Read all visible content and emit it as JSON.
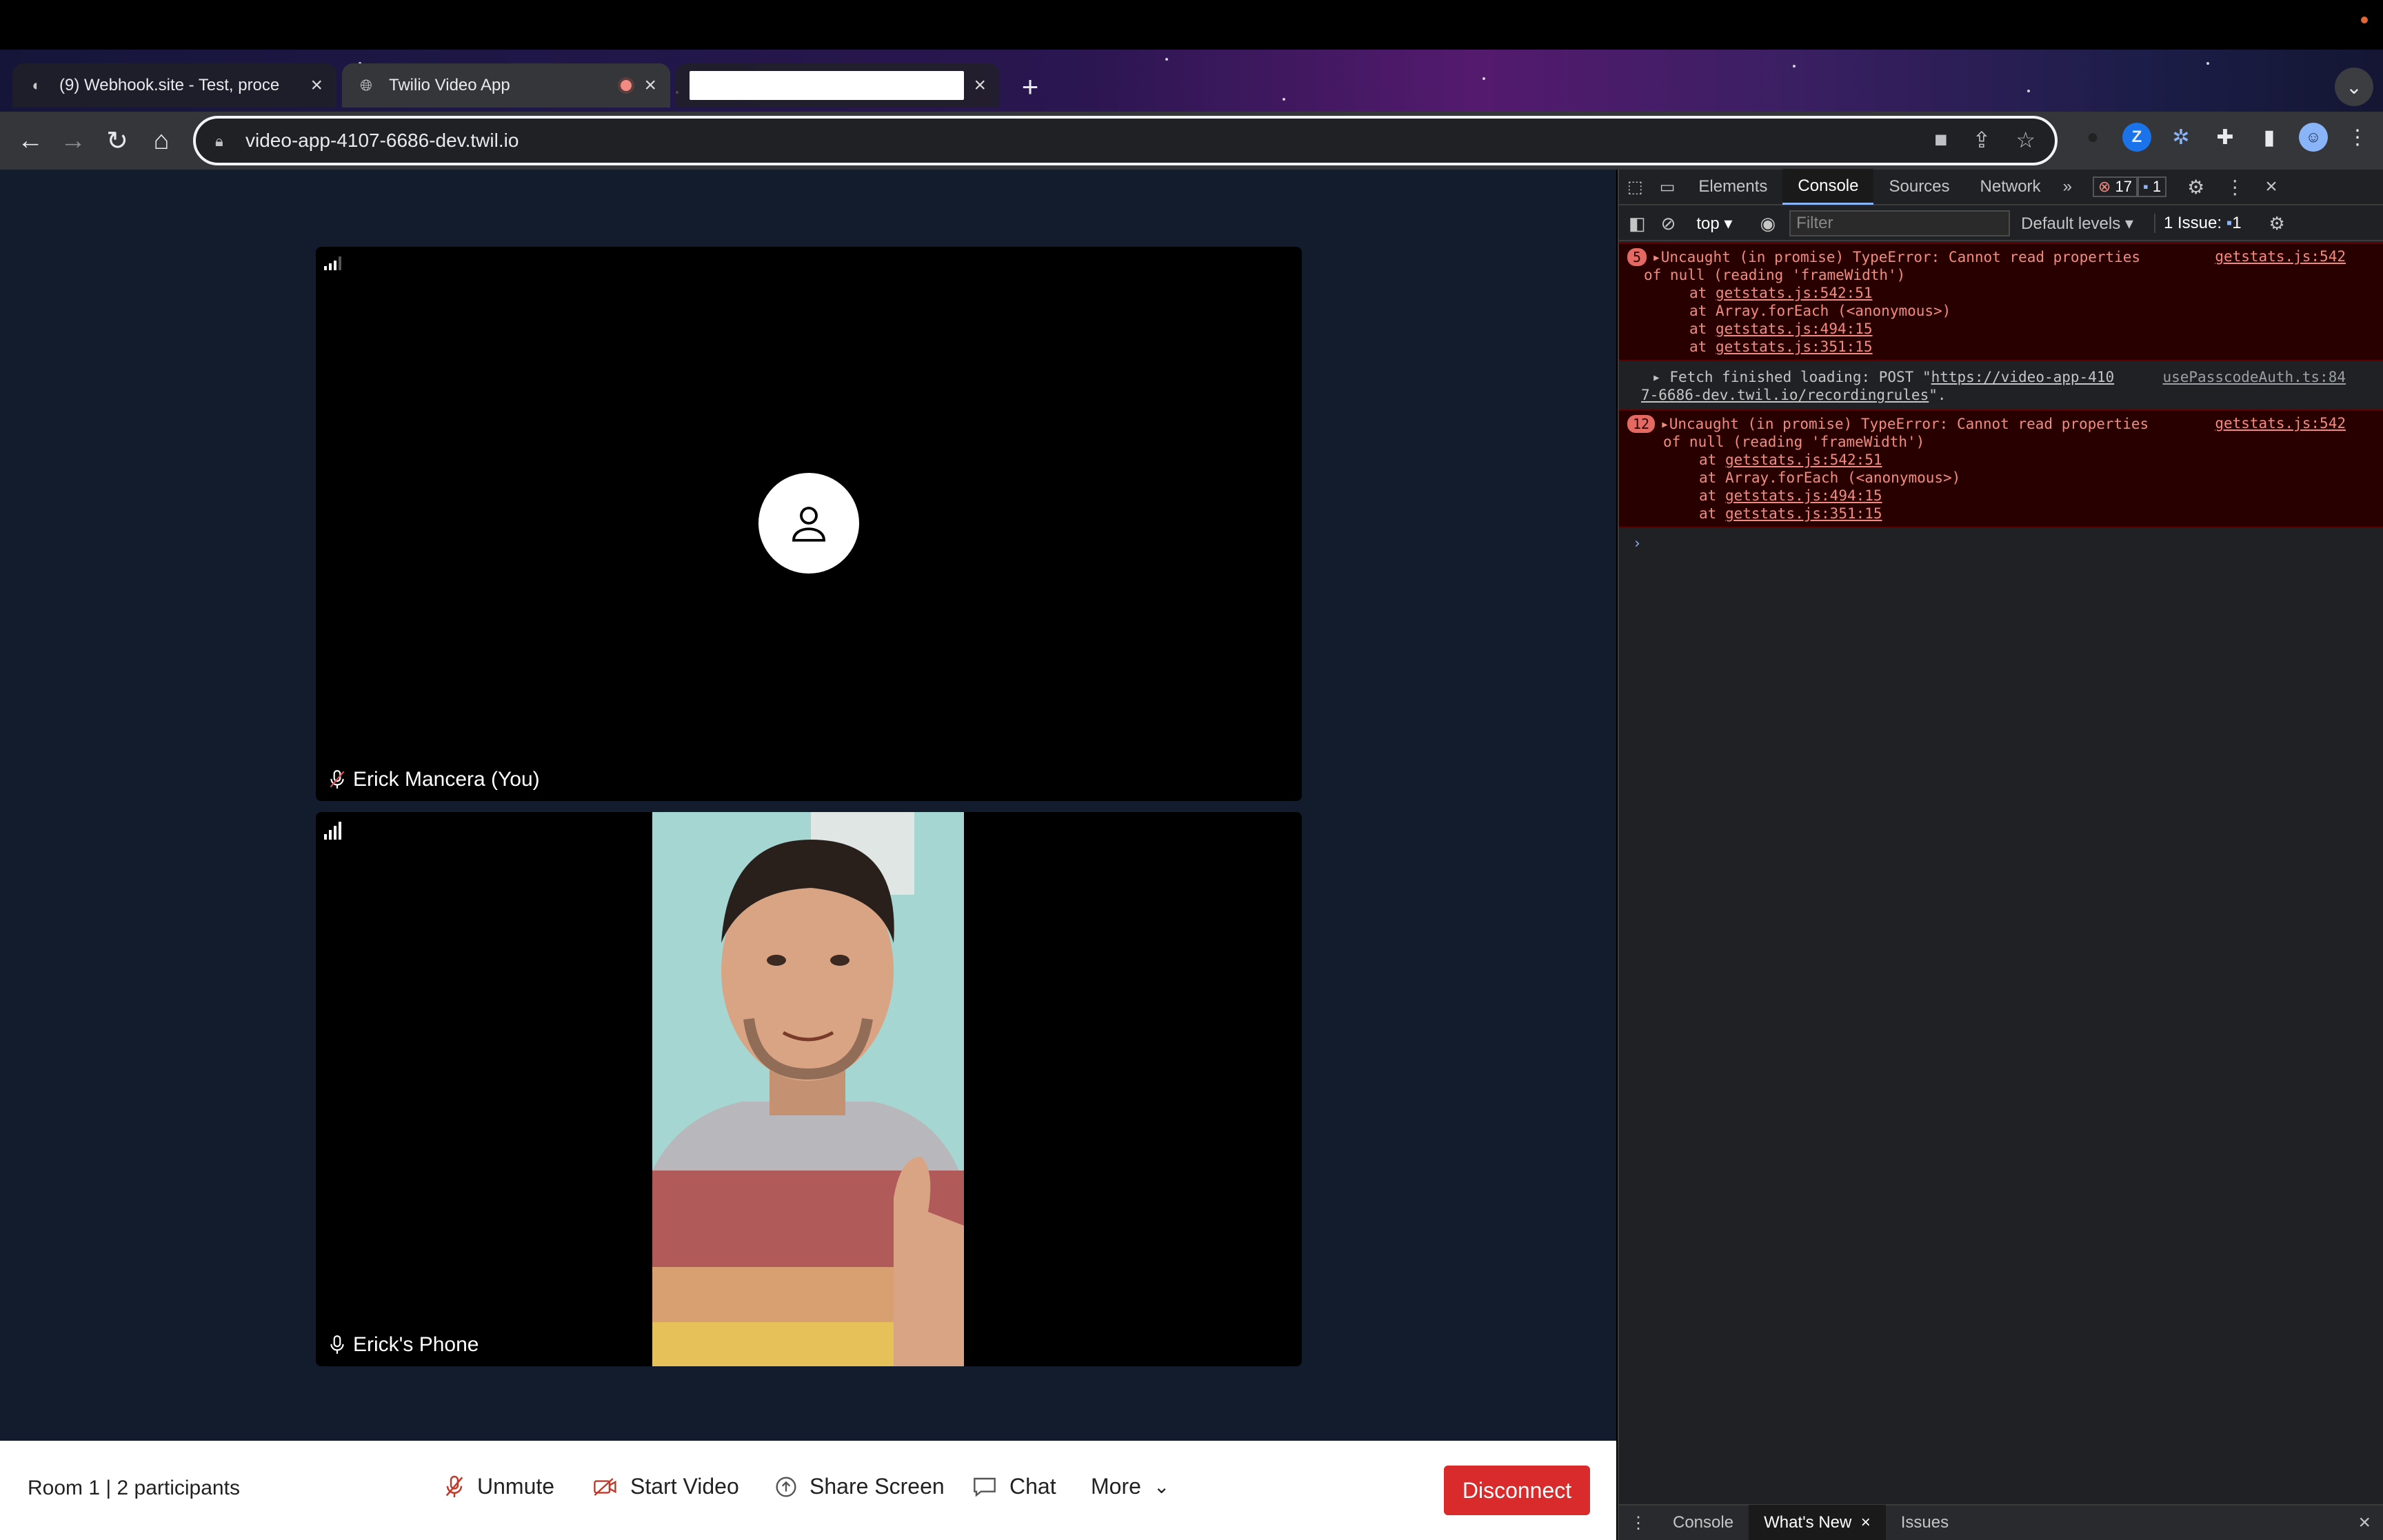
{
  "browser": {
    "tabs": [
      {
        "title": "(9) Webhook.site - Test, proce",
        "active": false
      },
      {
        "title": "Twilio Video App",
        "active": true,
        "recording": true
      },
      {
        "title": "",
        "active": false,
        "redacted": true
      }
    ],
    "url": "video-app-4107-6686-dev.twil.io"
  },
  "video": {
    "local_participant": "Erick Mancera (You)",
    "remote_participant": "Erick's Phone"
  },
  "bottom_bar": {
    "room_info": "Room 1 | 2 participants",
    "unmute": "Unmute",
    "start_video": "Start Video",
    "share_screen": "Share Screen",
    "chat": "Chat",
    "more": "More",
    "disconnect": "Disconnect"
  },
  "devtools": {
    "tabs": [
      "Elements",
      "Console",
      "Sources",
      "Network"
    ],
    "error_count": "17",
    "message_count": "1",
    "context": "top",
    "filter_placeholder": "Filter",
    "levels": "Default levels",
    "issues_label": "1 Issue:",
    "issues_count": "1",
    "messages": [
      {
        "count": "5",
        "text1": "Uncaught (in promise) TypeError: Cannot read properties",
        "text2": "of null (reading 'frameWidth')",
        "source": "getstats.js:542",
        "stack": [
          "getstats.js:542:51",
          "Array.forEach (<anonymous>)",
          "getstats.js:494:15",
          "getstats.js:351:15"
        ]
      },
      {
        "text1": "Fetch finished loading: POST \"",
        "link1": "https://video-app-410",
        "link2": "7-6686-dev.twil.io/recordingrules",
        "tail": "\".",
        "source": "usePasscodeAuth.ts:84"
      },
      {
        "count": "12",
        "text1": "Uncaught (in promise) TypeError: Cannot read properties",
        "text2": "of null (reading 'frameWidth')",
        "source": "getstats.js:542",
        "stack": [
          "getstats.js:542:51",
          "Array.forEach (<anonymous>)",
          "getstats.js:494:15",
          "getstats.js:351:15"
        ]
      }
    ],
    "at": "at",
    "drawer_tabs": [
      "Console",
      "What's New",
      "Issues"
    ]
  }
}
